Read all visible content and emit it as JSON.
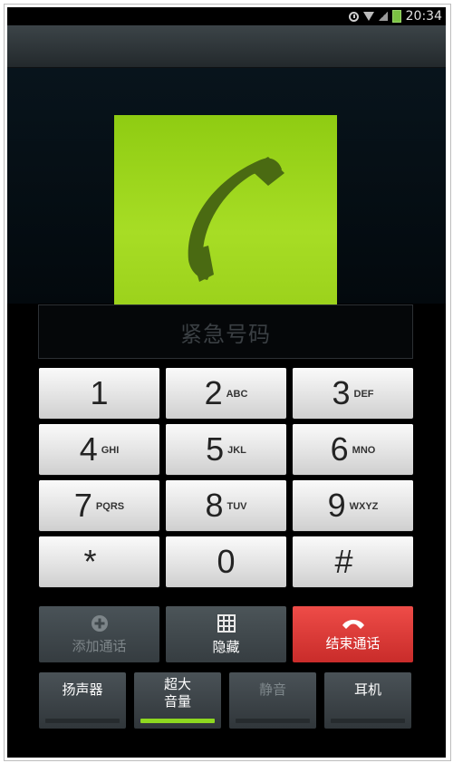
{
  "status_bar": {
    "time": "20:34",
    "icons": [
      "alarm-icon",
      "wifi-icon",
      "signal-icon",
      "battery-icon"
    ],
    "battery_color": "#7bc243"
  },
  "caller": {
    "name": "紧急号码",
    "photo_icon": "phone-handset-icon",
    "photo_color": "#9bd11b"
  },
  "dialpad": {
    "keys": [
      {
        "num": "1",
        "letters": ""
      },
      {
        "num": "2",
        "letters": "ABC"
      },
      {
        "num": "3",
        "letters": "DEF"
      },
      {
        "num": "4",
        "letters": "GHI"
      },
      {
        "num": "5",
        "letters": "JKL"
      },
      {
        "num": "6",
        "letters": "MNO"
      },
      {
        "num": "7",
        "letters": "PQRS"
      },
      {
        "num": "8",
        "letters": "TUV"
      },
      {
        "num": "9",
        "letters": "WXYZ"
      },
      {
        "num": "*",
        "letters": ""
      },
      {
        "num": "0",
        "letters": ""
      },
      {
        "num": "#",
        "letters": ""
      }
    ]
  },
  "actions": {
    "add_call": {
      "label": "添加通话",
      "icon": "add-circle-icon",
      "enabled": false
    },
    "hide": {
      "label": "隐藏",
      "icon": "keypad-grid-icon",
      "enabled": true
    },
    "end_call": {
      "label": "结束通话",
      "icon": "end-call-icon",
      "color": "#d93633"
    }
  },
  "toggles": [
    {
      "label": "扬声器",
      "on": false,
      "enabled": true
    },
    {
      "label": "超大\n音量",
      "on": true,
      "enabled": true
    },
    {
      "label": "静音",
      "on": false,
      "enabled": false
    },
    {
      "label": "耳机",
      "on": false,
      "enabled": true
    }
  ],
  "accent_color": "#8ed820"
}
